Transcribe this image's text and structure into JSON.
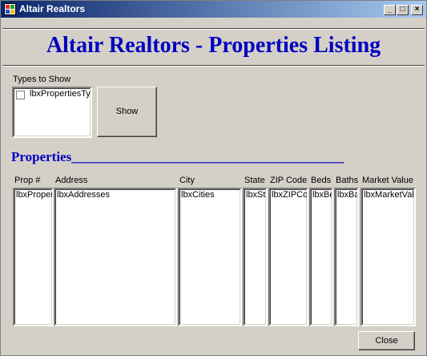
{
  "window": {
    "title": "Altair Realtors"
  },
  "titlebar_buttons": {
    "minimize": "_",
    "maximize": "□",
    "close": "×"
  },
  "header": {
    "title": "Altair Realtors - Properties Listing"
  },
  "types": {
    "group_label": "Types to Show",
    "list_item": "lbxPropertiesTypes",
    "show_button": "Show"
  },
  "properties": {
    "heading": "Properties________________________________________",
    "columns": [
      {
        "label": "Prop #",
        "list": "lbxPropertyNumbers"
      },
      {
        "label": "Address",
        "list": "lbxAddresses"
      },
      {
        "label": "City",
        "list": "lbxCities"
      },
      {
        "label": "State",
        "list": "lbxStates"
      },
      {
        "label": "ZIP Code",
        "list": "lbxZIPCodes"
      },
      {
        "label": "Beds",
        "list": "lbxBedrooms"
      },
      {
        "label": "Baths",
        "list": "lbxBathrooms"
      },
      {
        "label": "Market Value",
        "list": "lbxMarketValues"
      }
    ]
  },
  "footer": {
    "close_button": "Close"
  }
}
